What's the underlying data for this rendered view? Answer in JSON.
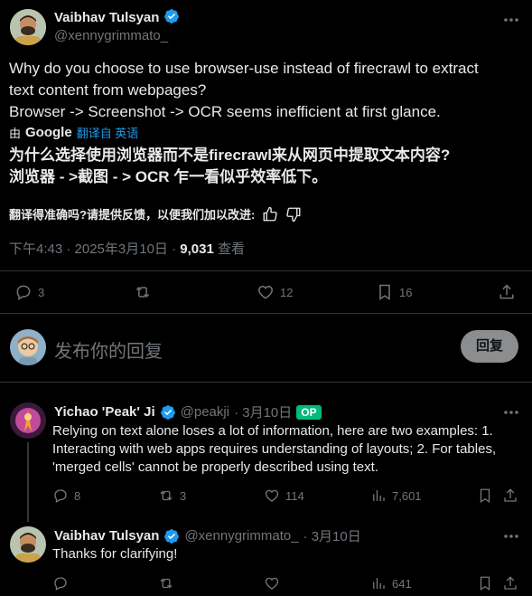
{
  "main_tweet": {
    "author_name": "Vaibhav Tulsyan",
    "author_handle": "@xennygrimmato_",
    "text_en_line1": "Why do you choose to use browser-use instead of firecrawl to extract",
    "text_en_line2": "text content from webpages?",
    "text_en_line3": "Browser -> Screenshot -> OCR seems inefficient at first glance.",
    "translated_by": "由",
    "google": "Google",
    "translated_from": "翻译自 英语",
    "text_zh_line1": "为什么选择使用浏览器而不是firecrawl来从网页中提取文本内容?",
    "text_zh_line2": "浏览器 - >截图 - > OCR 乍一看似乎效率低下。",
    "feedback": "翻译得准确吗?请提供反馈，以便我们加以改进:",
    "time": "下午4:43 · 2025年3月10日 · ",
    "views": "9,031",
    "views_label": "查看",
    "replies": "3",
    "likes": "12",
    "bookmarks": "16"
  },
  "compose": {
    "placeholder": "发布你的回复",
    "button": "回复"
  },
  "reply1": {
    "author_name": "Yichao 'Peak' Ji",
    "author_handle": "@peakji",
    "date": "· 3月10日",
    "badge": "OP",
    "text_line1": "Relying on text alone loses a lot of information, here are two examples: 1.",
    "text_line2": "Interacting with web apps requires understanding of layouts; 2. For tables,",
    "text_line3": "'merged cells' cannot be properly described using text.",
    "replies": "8",
    "retweets": "3",
    "likes": "114",
    "views": "7,601"
  },
  "reply2": {
    "author_name": "Vaibhav Tulsyan",
    "author_handle": "@xennygrimmato_",
    "date": "· 3月10日",
    "text": "Thanks for clarifying!",
    "views": "641"
  },
  "colors": {
    "accent": "#1d9bf0",
    "muted": "#71767b",
    "op_badge": "#00ba7c"
  }
}
